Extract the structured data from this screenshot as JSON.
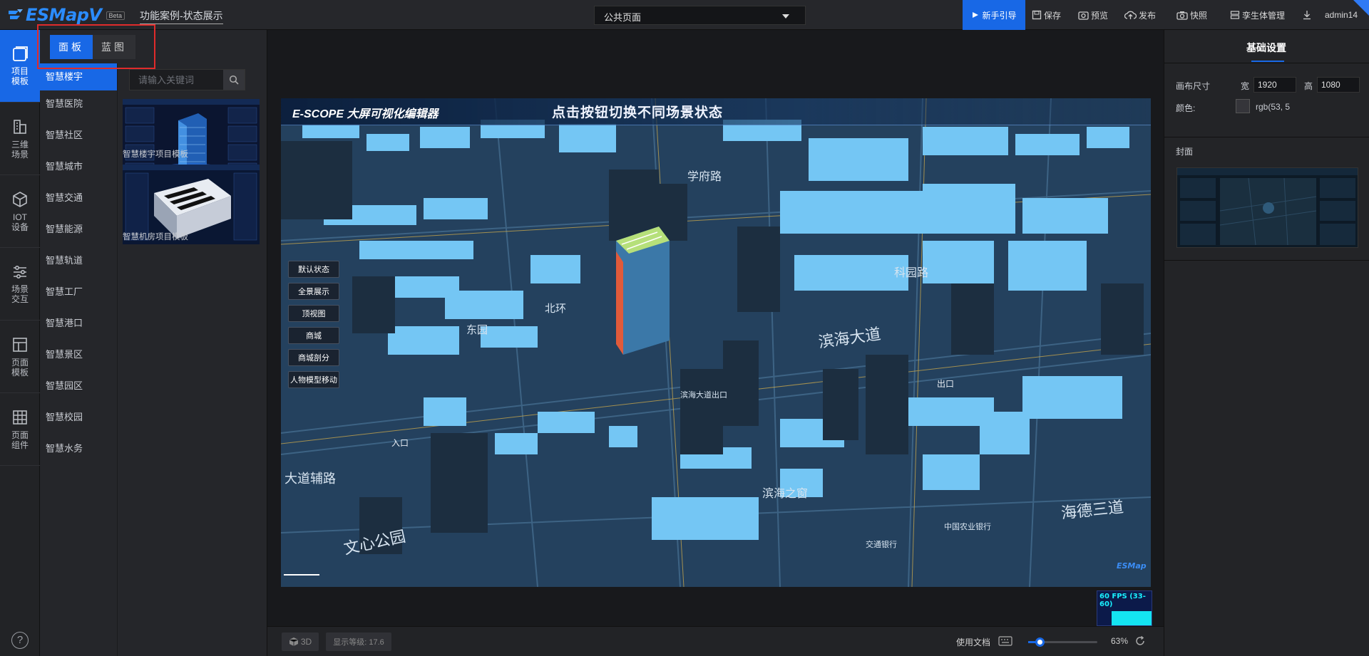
{
  "header": {
    "logo_text": "ESMapV",
    "logo_badge": "Beta",
    "project_title": "功能案例-状态展示",
    "page_select": "公共页面",
    "buttons": {
      "guide": "新手引导",
      "save": "保存",
      "preview": "预览",
      "publish": "发布",
      "snapshot": "快照",
      "twin_manage": "孪生体管理",
      "user": "admin14"
    }
  },
  "leftnav": {
    "items": [
      {
        "label1": "项目",
        "label2": "模板"
      },
      {
        "label1": "三维",
        "label2": "场景"
      },
      {
        "label1": "IOT",
        "label2": "设备"
      },
      {
        "label1": "场景",
        "label2": "交互"
      },
      {
        "label1": "页面",
        "label2": "模板"
      },
      {
        "label1": "页面",
        "label2": "组件"
      }
    ],
    "help": "?"
  },
  "panel": {
    "tabs": [
      "面板",
      "蓝图"
    ],
    "search_placeholder": "请输入关键词",
    "categories": [
      "智慧楼宇",
      "智慧医院",
      "智慧社区",
      "智慧城市",
      "智慧交通",
      "智慧能源",
      "智慧轨道",
      "智慧工厂",
      "智慧港口",
      "智慧景区",
      "智慧园区",
      "智慧校园",
      "智慧水务"
    ],
    "templates": [
      {
        "label": "智慧楼宇项目模板"
      },
      {
        "label": "智慧机房项目模板"
      }
    ]
  },
  "stage": {
    "brand": "E-SCOPE 大屏可视化编辑器",
    "title": "点击按钮切换不同场景状态",
    "state_buttons": [
      "默认状态",
      "全景展示",
      "顶视图",
      "商城",
      "商城剖分",
      "人物模型移动"
    ],
    "map_labels": [
      "滨海大道",
      "滨海大道出口",
      "文心公园",
      "大道辅路",
      "入口",
      "出口",
      "科园路",
      "海德三道",
      "学府路",
      "滨海之窗",
      "交通银行",
      "中国农业银行",
      "北环",
      "东园"
    ],
    "fps": "60 FPS (33-60)"
  },
  "bottombar": {
    "mode_3d": "3D",
    "level": "显示等级: 17.6",
    "doc": "使用文档",
    "zoom": "63%",
    "zoom_fraction": 0.63
  },
  "rightpanel": {
    "tab": "基础设置",
    "canvas_size_label": "画布尺寸",
    "width_label": "宽",
    "width_value": "1920",
    "height_label": "高",
    "height_value": "1080",
    "color_label": "颜色:",
    "color_value": "rgb(53, 5",
    "cover_label": "封面"
  },
  "colors": {
    "accent": "#1868e6",
    "highlight_box": "#e02b2b",
    "fps_text": "#19f0ff"
  }
}
